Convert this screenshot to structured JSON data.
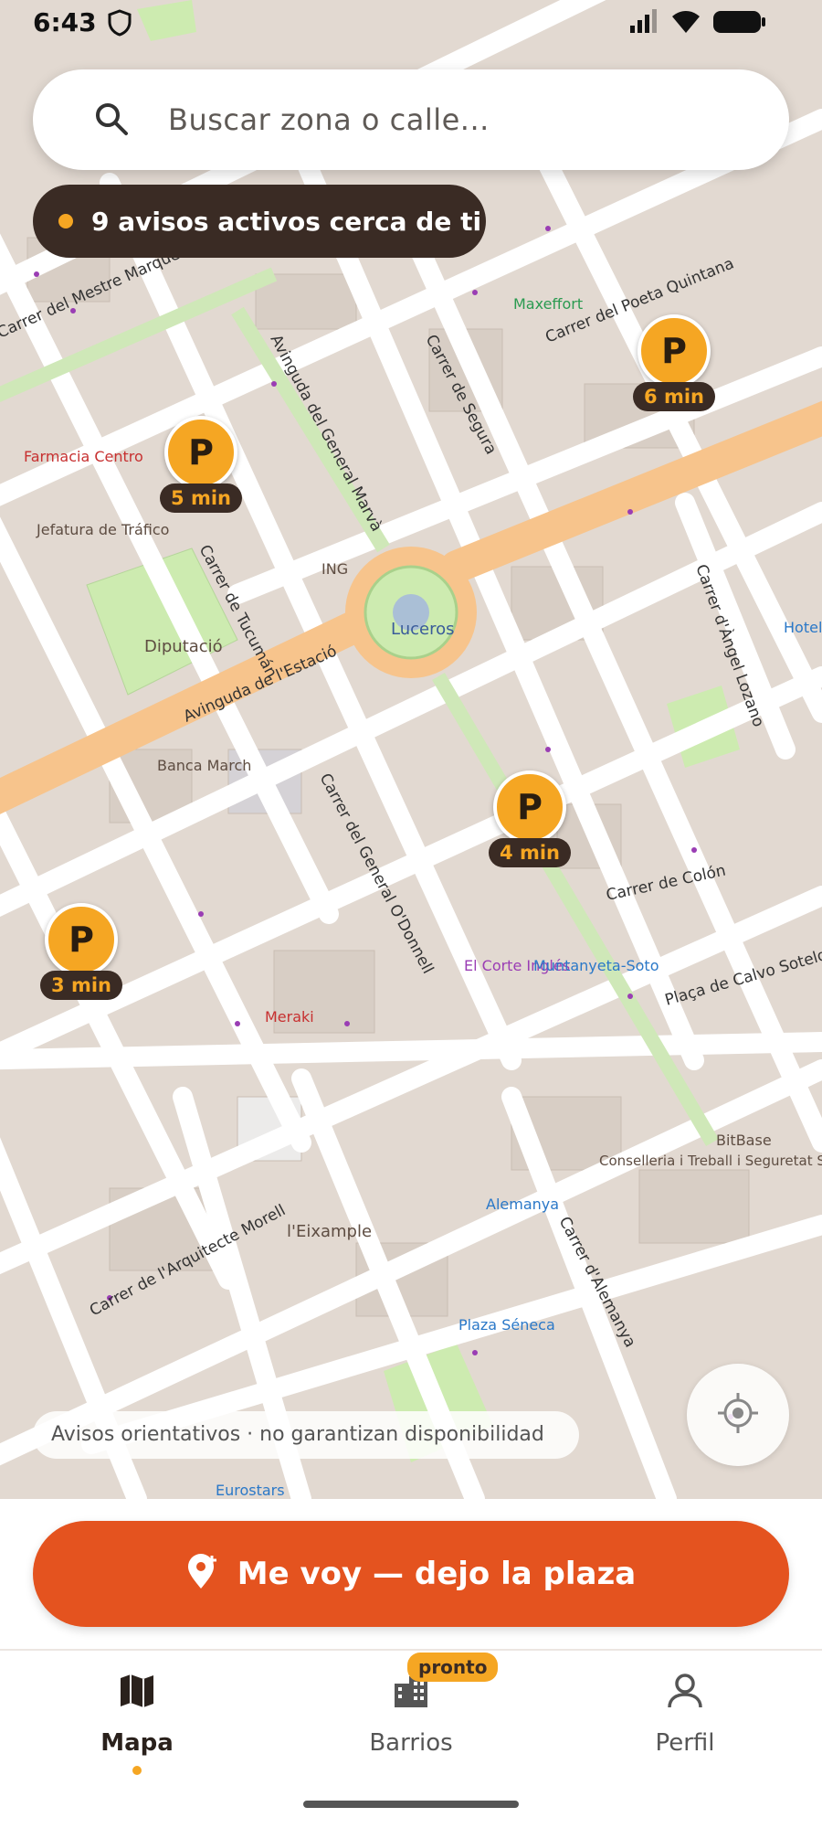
{
  "status_bar": {
    "time": "6:43"
  },
  "search": {
    "placeholder": "Buscar zona o calle..."
  },
  "alerts_pill": {
    "text": "9 avisos activos cerca de ti"
  },
  "map": {
    "streets": [
      "Avinguda del General Marvà",
      "Carrer de Segura",
      "Carrer del Poeta Quintana",
      "Carrer del Mestre Marqués",
      "Carrer de Tucumán",
      "Avinguda de l'Estació",
      "Carrer del General O'Donnell",
      "Carrer de Colón",
      "Carrer d'Àngel Lozano",
      "Plaça de Calvo Sotelo",
      "Carrer de l'Arquitecte Morell",
      "Carrer d'Alemanya"
    ],
    "places": [
      "Farmacia Centro",
      "Jefatura de Tráfico",
      "Diputació",
      "Luceros",
      "ING",
      "Banca March",
      "El Corte Inglés",
      "Muntanyeta-Soto",
      "Meraki",
      "l'Eixample",
      "Alemanya",
      "Plaza Séneca",
      "Conselleria i Treball i Seguretat Social",
      "BitBase",
      "Maxeffort",
      "Eurostars",
      "Hotel"
    ],
    "pins": [
      {
        "label": "P",
        "time": "6 min"
      },
      {
        "label": "P",
        "time": "5 min"
      },
      {
        "label": "P",
        "time": "4 min"
      },
      {
        "label": "P",
        "time": "3 min"
      }
    ]
  },
  "disclaimer": "Avisos orientativos · no garantizan disponibilidad",
  "cta": {
    "label": "Me voy — dejo la plaza",
    "icon": "map-pin-plus-icon"
  },
  "tabs": [
    {
      "label": "Mapa",
      "icon": "map-icon",
      "active": true
    },
    {
      "label": "Barrios",
      "icon": "buildings-icon",
      "badge": "pronto"
    },
    {
      "label": "Perfil",
      "icon": "user-icon"
    }
  ],
  "colors": {
    "accent": "#f5a623",
    "cta": "#e4531f",
    "pill_dark": "#3a2b24",
    "map_base": "#e2d9d1",
    "road": "#ffffff",
    "main_road": "#f7c48c",
    "park": "#cdebb0"
  }
}
